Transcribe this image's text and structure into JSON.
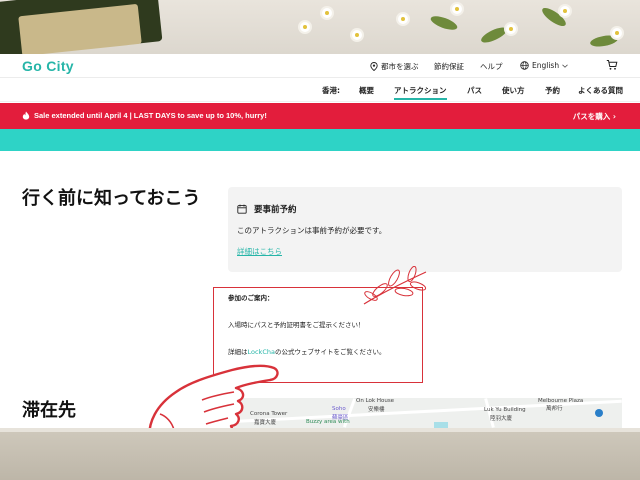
{
  "header": {
    "logo": "Go City",
    "city_selector": "都市を選ぶ",
    "savings": "節約保証",
    "help": "ヘルプ",
    "language": "English"
  },
  "subnav": {
    "items": [
      "香港:",
      "概要",
      "アトラクション",
      "パス",
      "使い方",
      "予約",
      "よくある質問"
    ],
    "active_index": 2
  },
  "promo": {
    "text": "Sale extended until April 4 | LAST DAYS to save up to 10%, hurry!",
    "cta": "パスを購入 ›"
  },
  "before_you_go": {
    "heading": "行く前に知っておこう",
    "card_title": "要事前予約",
    "card_desc": "このアトラクションは事前予約が必要です。",
    "card_link": "詳細はこちら"
  },
  "notice": {
    "title": "参加のご案内：",
    "line1": "入場時にパスと予約証明書をご提示ください！",
    "line2_prefix": "詳細は",
    "line2_link": "LockCha",
    "line2_suffix": "の公式ウェブサイトをご覧ください。"
  },
  "stay": {
    "heading": "滞在先"
  },
  "map": {
    "labels": [
      "On Lok House",
      "安樂樓",
      "Soho",
      "蘇豪區",
      "Corona Tower",
      "嘉寶大廈",
      "Buzzy area with",
      "Luk Yu Building",
      "陸羽大廈",
      "Melbourne Plaza",
      "萬邦行"
    ]
  },
  "colors": {
    "brand": "#26b5a8",
    "promo": "#e31d3c",
    "teal_band": "#2ed3c6",
    "annotation": "#d8323a"
  }
}
